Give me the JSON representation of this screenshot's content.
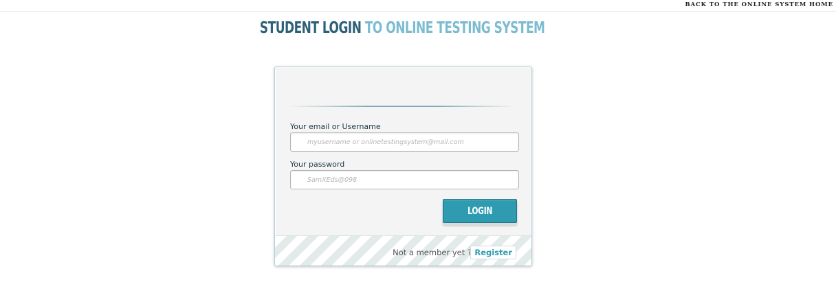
{
  "header": {
    "back_link": "BACK TO THE ONLINE SYSTEM HOME"
  },
  "title": {
    "part1": "STUDENT LOGIN",
    "part2": "TO ONLINE TESTING SYSTEM"
  },
  "login_form": {
    "username_label": "Your email or Username",
    "username_placeholder": "myusername or onlinetestingsystem@mail.com",
    "username_value": "",
    "password_label": "Your password",
    "password_placeholder": "SamXEds@098",
    "password_value": "",
    "login_button": "LOGIN"
  },
  "footer": {
    "prompt": "Not a member yet ?",
    "register_link": "Register"
  },
  "colors": {
    "title_dark": "#2d6079",
    "title_light": "#7bbcd1",
    "accent": "#2e9bb0"
  }
}
